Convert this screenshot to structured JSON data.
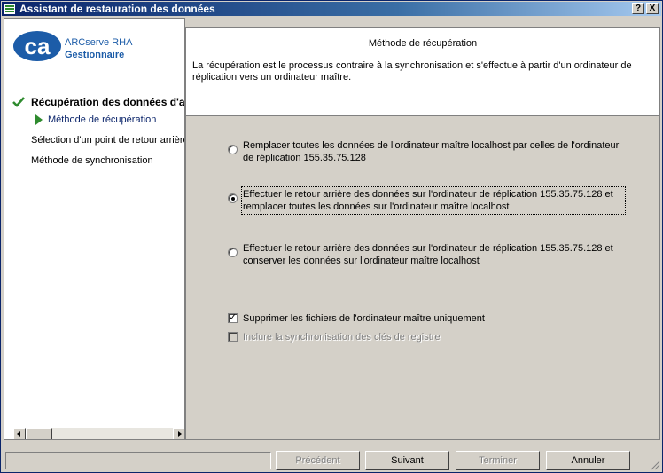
{
  "window": {
    "title": "Assistant de restauration des données",
    "help_label": "?",
    "close_label": "X"
  },
  "brand": {
    "logo_text": "ca",
    "product": "ARCserve RHA",
    "role": "Gestionnaire"
  },
  "steps": {
    "main": "Récupération des données d'ap",
    "current": "Méthode de récupération",
    "step3": "Sélection d'un point de retour arrière",
    "step4": "Méthode de synchronisation"
  },
  "panel": {
    "title": "Méthode de récupération",
    "description": "La récupération est le processus contraire à la synchronisation et s'effectue à partir d'un ordinateur de réplication vers un ordinateur maître."
  },
  "options": [
    {
      "label": "Remplacer toutes les données de l'ordinateur maître localhost par celles de l'ordinateur de réplication 155.35.75.128",
      "selected": false
    },
    {
      "label": "Effectuer le retour arrière des données sur l'ordinateur de réplication 155.35.75.128 et remplacer toutes les données sur l'ordinateur maître localhost",
      "selected": true
    },
    {
      "label": "Effectuer le retour arrière des données sur l'ordinateur de réplication 155.35.75.128 et conserver les données sur l'ordinateur maître localhost",
      "selected": false
    }
  ],
  "checkboxes": [
    {
      "label": "Supprimer les fichiers de l'ordinateur maître uniquement",
      "checked": true,
      "enabled": true
    },
    {
      "label": "Inclure la synchronisation des clés de registre",
      "checked": false,
      "enabled": false
    }
  ],
  "buttons": {
    "previous": "Précédent",
    "next": "Suivant",
    "finish": "Terminer",
    "cancel": "Annuler"
  },
  "colors": {
    "title_bar": "#0a246a",
    "brand_blue": "#1c5ca8",
    "check_green": "#2e8b2e"
  }
}
